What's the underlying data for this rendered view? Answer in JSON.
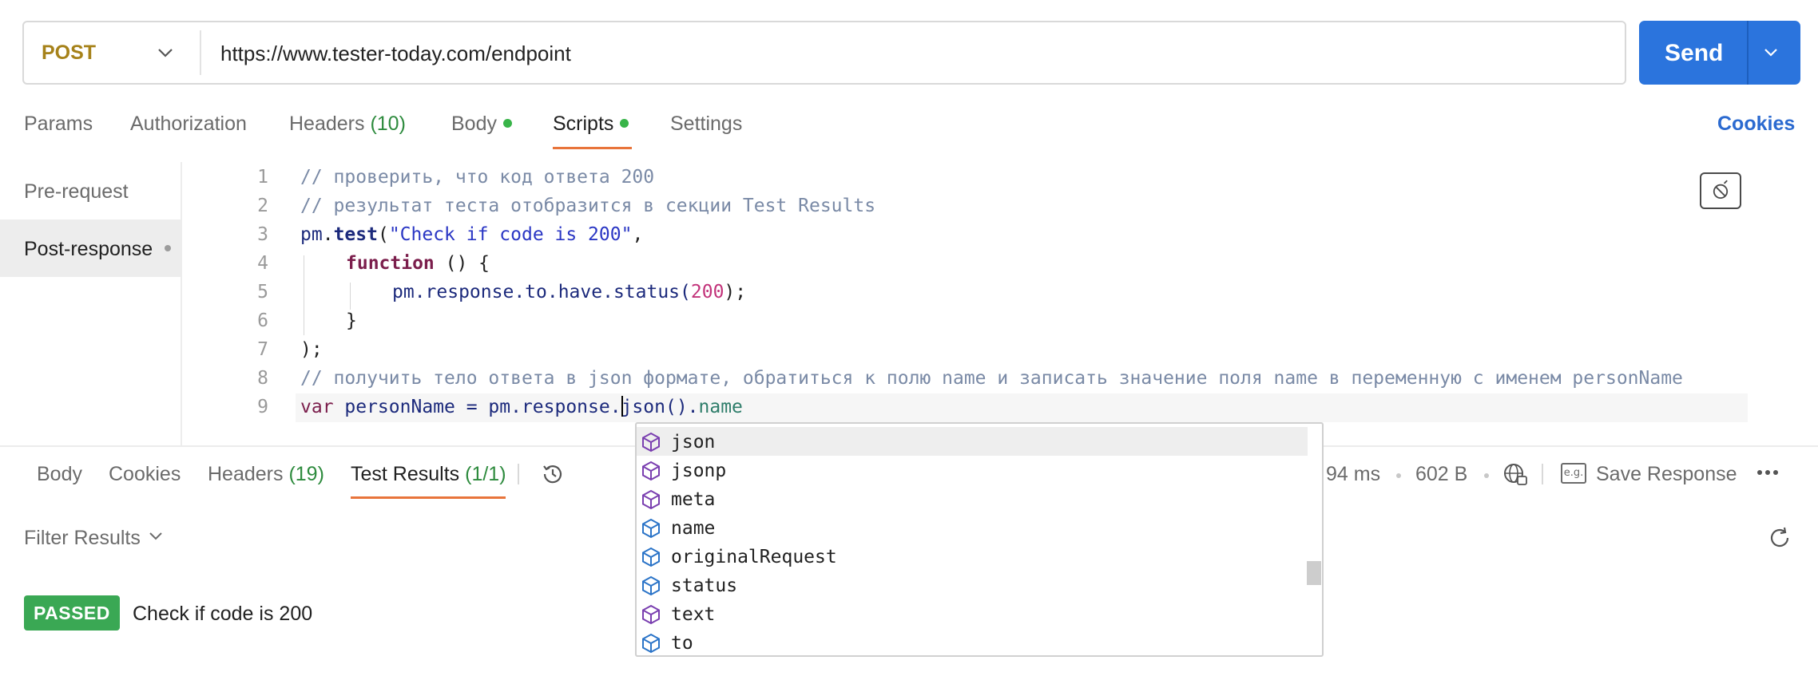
{
  "request": {
    "method": "POST",
    "url": "https://www.tester-today.com/endpoint",
    "send_label": "Send"
  },
  "request_tabs": {
    "params": "Params",
    "authorization": "Authorization",
    "headers": "Headers",
    "headers_count": "(10)",
    "body": "Body",
    "scripts": "Scripts",
    "settings": "Settings",
    "cookies": "Cookies"
  },
  "script_tabs": {
    "pre_request": "Pre-request",
    "post_response": "Post-response"
  },
  "editor": {
    "line_numbers": [
      "1",
      "2",
      "3",
      "4",
      "5",
      "6",
      "7",
      "8",
      "9"
    ],
    "line1": "// проверить, что код ответа 200",
    "line2": "// результат теста отобразится в секции Test Results",
    "line3_obj": "pm",
    "line3_dot": ".",
    "line3_fn": "test",
    "line3_paren": "(",
    "line3_str": "\"Check if code is 200\"",
    "line3_comma": ",",
    "line4_kw": "function",
    "line4_rest": " () {",
    "line5_code": "pm.response.to.have.status(",
    "line5_num": "200",
    "line5_end": ");",
    "line6": "}",
    "line7": ");",
    "line8": "// получить тело ответа в json формате, обратиться к полю name и записать значение поля name в переменную с именем personName",
    "line9_kw": "var",
    "line9_code": " personName = pm.response.",
    "line9_after_cursor": "json().",
    "line9_prop": "name"
  },
  "autocomplete": {
    "items": [
      {
        "label": "json",
        "icon": "method-cube-icon"
      },
      {
        "label": "jsonp",
        "icon": "method-cube-icon"
      },
      {
        "label": "meta",
        "icon": "method-cube-icon"
      },
      {
        "label": "name",
        "icon": "property-cube-icon"
      },
      {
        "label": "originalRequest",
        "icon": "property-cube-icon"
      },
      {
        "label": "status",
        "icon": "property-cube-icon"
      },
      {
        "label": "text",
        "icon": "method-cube-icon"
      },
      {
        "label": "to",
        "icon": "property-cube-icon"
      }
    ],
    "selected": "json"
  },
  "response_tabs": {
    "body": "Body",
    "cookies": "Cookies",
    "headers": "Headers",
    "headers_count": "(19)",
    "test_results": "Test Results",
    "test_results_count": "(1/1)"
  },
  "response_meta": {
    "time": "94 ms",
    "size": "602 B",
    "save_response": "Save Response",
    "eg_badge": "e.g."
  },
  "results": {
    "filter_label": "Filter Results",
    "status": "PASSED",
    "test_name": "Check if code is 200"
  },
  "colors": {
    "accent": "#2b74dd",
    "active_tab_underline": "#e8743b",
    "passed": "#3aa854",
    "method": "#a6821a"
  }
}
